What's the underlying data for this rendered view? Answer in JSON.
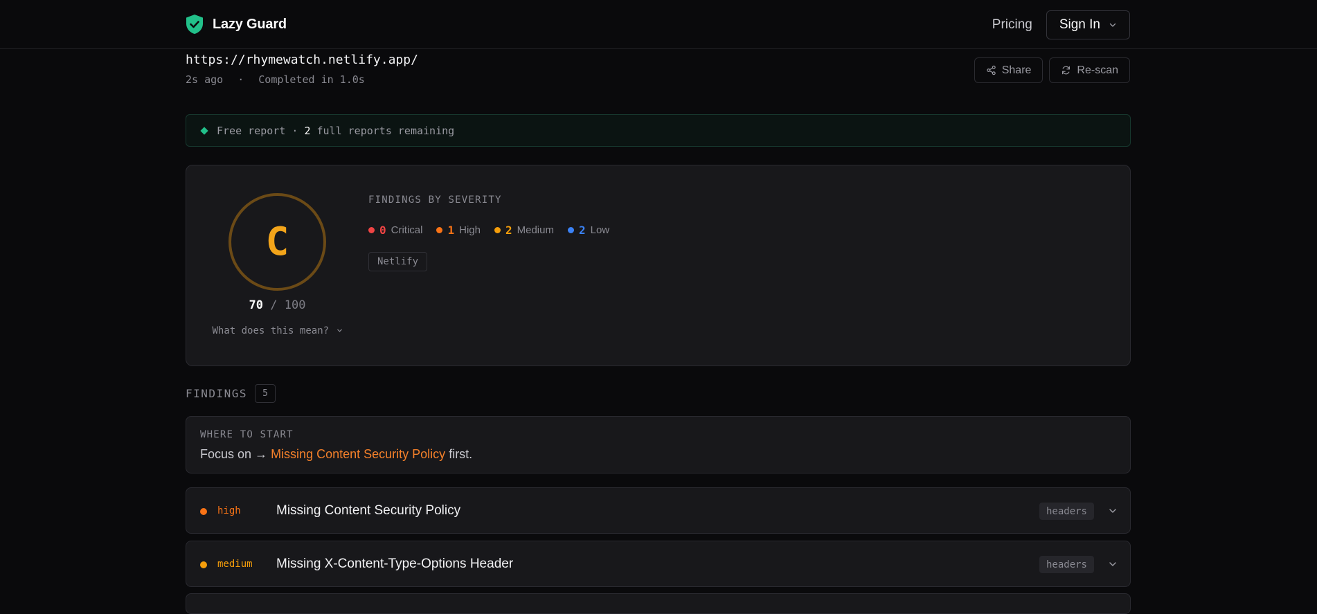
{
  "nav": {
    "brand": "Lazy Guard",
    "pricing_label": "Pricing",
    "signin_label": "Sign In"
  },
  "scan": {
    "url": "https://rhymewatch.netlify.app/",
    "age": "2s ago",
    "separator": "·",
    "duration": "Completed in 1.0s",
    "share_label": "Share",
    "rescan_label": "Re-scan"
  },
  "banner": {
    "prefix": "Free report ·",
    "count": "2",
    "suffix": "full reports remaining"
  },
  "score": {
    "grade": "C",
    "value": "70",
    "max": "/ 100",
    "help_label": "What does this mean?"
  },
  "severity": {
    "title": "FINDINGS BY SEVERITY",
    "items": [
      {
        "count": "0",
        "label": "Critical",
        "color": "#ef4444"
      },
      {
        "count": "1",
        "label": "High",
        "color": "#f97316"
      },
      {
        "count": "2",
        "label": "Medium",
        "color": "#f59e0b"
      },
      {
        "count": "2",
        "label": "Low",
        "color": "#3b82f6"
      }
    ],
    "platform": "Netlify"
  },
  "findings": {
    "label": "FINDINGS",
    "count": "5",
    "start": {
      "kicker": "WHERE TO START",
      "prefix": "Focus on →",
      "link": "Missing Content Security Policy",
      "suffix": "first."
    },
    "rows": [
      {
        "severity": "high",
        "color": "#f97316",
        "title": "Missing Content Security Policy",
        "category": "headers"
      },
      {
        "severity": "medium",
        "color": "#f59e0b",
        "title": "Missing X-Content-Type-Options Header",
        "category": "headers"
      }
    ]
  },
  "colors": {
    "accent_green": "#22c08a",
    "grade_amber": "#f2a41a"
  }
}
